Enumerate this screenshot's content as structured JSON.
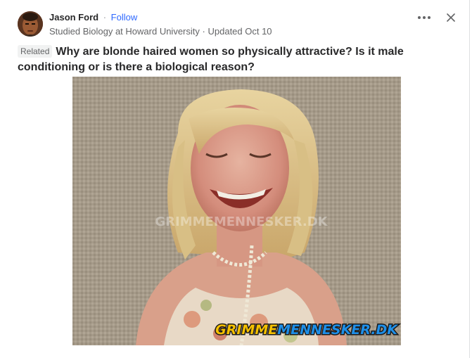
{
  "author": {
    "name": "Jason Ford",
    "separator": "·",
    "follow_label": "Follow",
    "credential": "Studied Biology at Howard University",
    "updated": "Updated Oct 10"
  },
  "post": {
    "related_label": "Related",
    "question": "Why are blonde haired women so physically attractive? Is it male conditioning or is there a biological reason?"
  },
  "image": {
    "watermark_center": "GRIMMEMENNESKER.DK",
    "watermark_corner_a": "GRIMME",
    "watermark_corner_b": "MENNESKER.DK"
  },
  "icons": {
    "more": "more-horizontal-icon",
    "close": "close-icon"
  },
  "colors": {
    "link": "#2e69ff",
    "text": "#282829",
    "muted": "#636466",
    "watermark_yellow": "#f5c000",
    "watermark_blue": "#1e8fe8"
  }
}
